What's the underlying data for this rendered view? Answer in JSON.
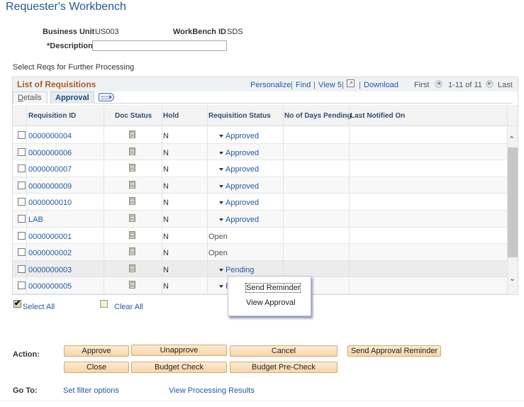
{
  "page": {
    "title": "Requester's Workbench"
  },
  "header": {
    "business_unit_label": "Business Unit",
    "business_unit_value": "US003",
    "workbench_id_label": "WorkBench ID",
    "workbench_id_value": "SDS",
    "description_label": "*Description",
    "description_value": ""
  },
  "section_label": "Select Reqs for Further Processing",
  "grid": {
    "title": "List of Requisitions",
    "nav": {
      "personalize": "Personalize",
      "find": "Find",
      "view": "View 5",
      "download": "Download",
      "first": "First",
      "range": "1-11 of 11",
      "last": "Last",
      "separator": "|"
    },
    "tabs": [
      {
        "label": "Details",
        "active": false
      },
      {
        "label": "Approval",
        "active": true
      }
    ],
    "columns": [
      "Requisition ID",
      "Doc Status",
      "Hold",
      "Requisition Status",
      "No of Days Pending",
      "Last Notified On"
    ],
    "rows": [
      {
        "id": "0000000004",
        "hold": "N",
        "status": "Approved",
        "status_link": true,
        "days_pending": "",
        "last_notified": ""
      },
      {
        "id": "0000000006",
        "hold": "N",
        "status": "Approved",
        "status_link": true,
        "days_pending": "",
        "last_notified": ""
      },
      {
        "id": "0000000007",
        "hold": "N",
        "status": "Approved",
        "status_link": true,
        "days_pending": "",
        "last_notified": ""
      },
      {
        "id": "0000000009",
        "hold": "N",
        "status": "Approved",
        "status_link": true,
        "days_pending": "",
        "last_notified": ""
      },
      {
        "id": "0000000010",
        "hold": "N",
        "status": "Approved",
        "status_link": true,
        "days_pending": "",
        "last_notified": ""
      },
      {
        "id": "LAB",
        "hold": "N",
        "status": "Approved",
        "status_link": true,
        "days_pending": "",
        "last_notified": ""
      },
      {
        "id": "0000000001",
        "hold": "N",
        "status": "Open",
        "status_link": false,
        "days_pending": "",
        "last_notified": ""
      },
      {
        "id": "0000000002",
        "hold": "N",
        "status": "Open",
        "status_link": false,
        "days_pending": "",
        "last_notified": ""
      },
      {
        "id": "0000000003",
        "hold": "N",
        "status": "Pending",
        "status_link": true,
        "days_pending": "",
        "last_notified": ""
      },
      {
        "id": "0000000005",
        "hold": "N",
        "status": "P",
        "status_link": true,
        "days_pending": "",
        "last_notified": ""
      }
    ]
  },
  "popup_menu": {
    "items": [
      "Send Reminder",
      "View Approval"
    ]
  },
  "select_all": "Select All",
  "clear_all": "Clear All",
  "actions": {
    "label": "Action:",
    "approve": "Approve",
    "unapprove": "Unapprove",
    "cancel": "Cancel",
    "send_approval_reminder": "Send Approval Reminder",
    "close": "Close",
    "budget_check": "Budget Check",
    "budget_pre_check": "Budget Pre-Check"
  },
  "goto": {
    "label": "Go To:",
    "set_filter": "Set filter options",
    "view_results": "View Processing Results"
  },
  "colors": {
    "title": "#1e5b93",
    "link": "#1f5aa5",
    "grid_title": "#b05a1e",
    "button_bg": "#f7d6a8"
  }
}
